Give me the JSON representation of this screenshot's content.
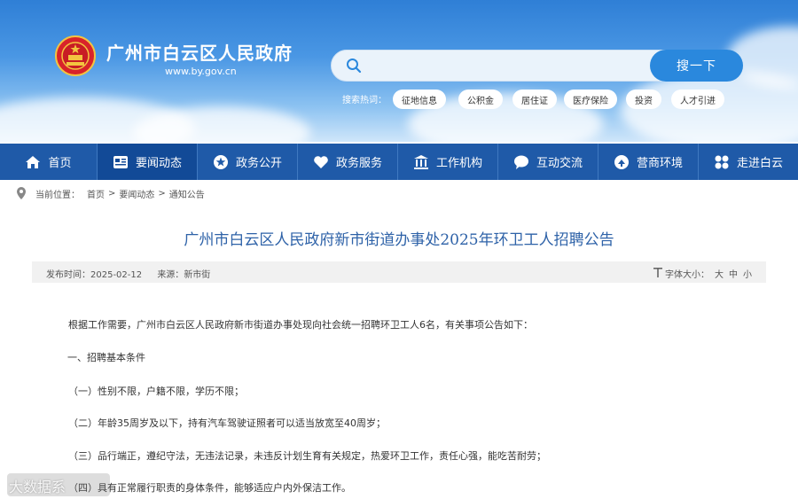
{
  "header": {
    "site_title": "广州市白云区人民政府",
    "site_domain": "www.by.gov.cn",
    "emblem_icon": "national-emblem-icon",
    "search": {
      "placeholder": "",
      "button_label": "搜一下",
      "icon": "search-icon"
    },
    "hot_search_label": "搜索热词：",
    "hot_tags": [
      "征地信息",
      "公积金",
      "居住证",
      "医疗保险",
      "投资",
      "人才引进"
    ]
  },
  "nav": {
    "items": [
      {
        "label": "首页",
        "icon": "home-icon"
      },
      {
        "label": "要闻动态",
        "icon": "news-icon"
      },
      {
        "label": "政务公开",
        "icon": "star-icon"
      },
      {
        "label": "政务服务",
        "icon": "heart-icon"
      },
      {
        "label": "工作机构",
        "icon": "building-icon"
      },
      {
        "label": "互动交流",
        "icon": "chat-icon"
      },
      {
        "label": "营商环境",
        "icon": "business-icon"
      },
      {
        "label": "走进白云",
        "icon": "grid-icon"
      }
    ],
    "active_index": 1
  },
  "breadcrumb": {
    "label": "当前位置：",
    "items": [
      "首页",
      "要闻动态",
      "通知公告"
    ],
    "separator": ">"
  },
  "article": {
    "title": "广州市白云区人民政府新市街道办事处2025年环卫工人招聘公告",
    "publish_label": "发布时间：",
    "publish_date": "2025-02-12",
    "source_label": "来源：",
    "source": "新市街",
    "font_size_label": "字体大小：",
    "font_sizes": [
      "大",
      "中",
      "小"
    ],
    "paragraphs": [
      "根据工作需要，广州市白云区人民政府新市街道办事处现向社会统一招聘环卫工人6名，有关事项公告如下：",
      "一、招聘基本条件",
      "（一）性别不限，户籍不限，学历不限；",
      "（二）年龄35周岁及以下，持有汽车驾驶证照者可以适当放宽至40周岁；",
      "（三）品行端正，遵纪守法，无违法记录，未违反计划生育有关规定，热爱环卫工作，责任心强，能吃苦耐劳；",
      "（四）具有正常履行职责的身体条件，能够适应户内外保洁工作。"
    ]
  },
  "watermark": "大数据系",
  "colors": {
    "nav_bg": "#1f5aa8",
    "nav_active": "#124a97",
    "title": "#2e62a8",
    "search_button": "#2a88dd"
  }
}
